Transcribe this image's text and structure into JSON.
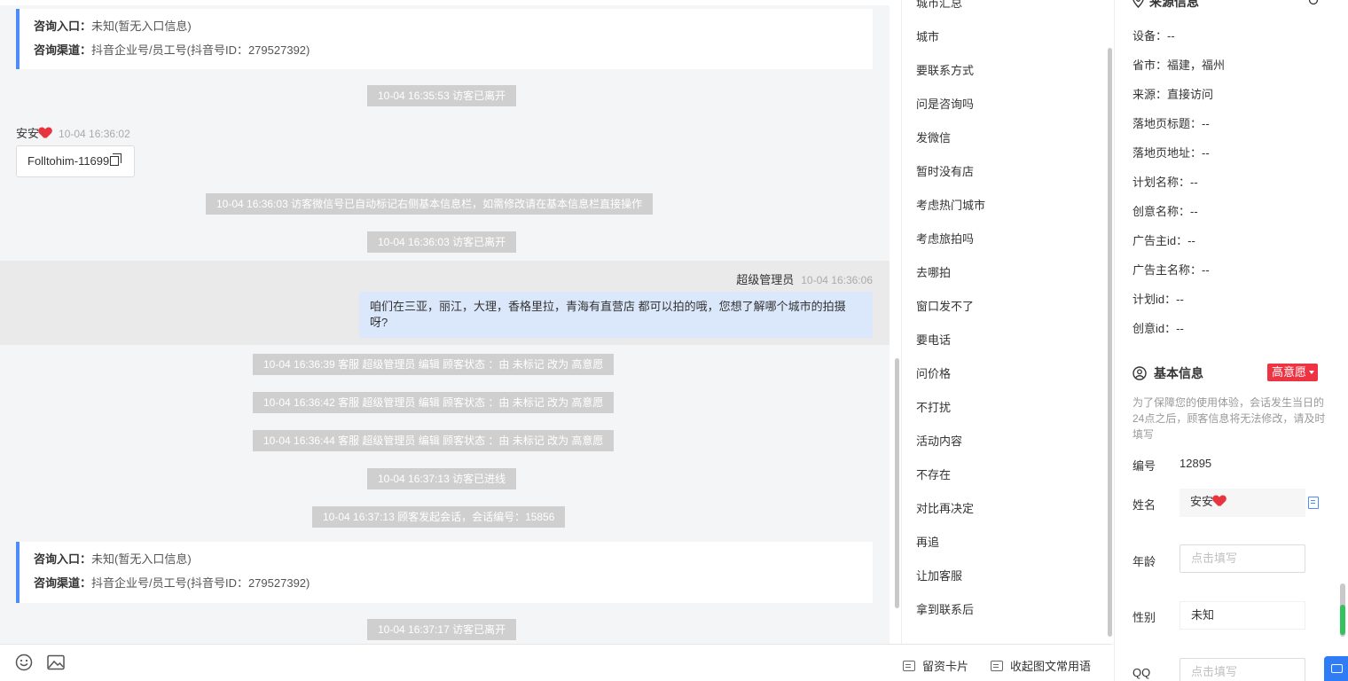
{
  "chat": {
    "card1": {
      "entry_label": "咨询入口：",
      "entry_value": "未知(暂无入口信息)",
      "channel_label": "咨询渠道：",
      "channel_value": "抖音企业号/员工号(抖音号ID：279527392)"
    },
    "sys1": "10-04 16:35:53 访客已离开",
    "visitor_name": "安安",
    "visitor_time": "10-04 16:36:02",
    "visitor_msg": "Folltohim-11699",
    "sys2": "10-04 16:36:03 访客微信号已自动标记右侧基本信息栏，如需修改请在基本信息栏直接操作",
    "sys3": "10-04 16:36:03 访客已离开",
    "admin_name": "超级管理员",
    "admin_time": "10-04 16:36:06",
    "admin_msg": "咱们在三亚，丽江，大理，香格里拉，青海有直营店 都可以拍的哦，您想了解哪个城市的拍摄呀?",
    "sys4": "10-04 16:36:39 客服 超级管理员 编辑 顾客状态 ：由 未标记 改为 高意愿",
    "sys5": "10-04 16:36:42 客服 超级管理员 编辑 顾客状态 ：由 未标记 改为 高意愿",
    "sys6": "10-04 16:36:44 客服 超级管理员 编辑 顾客状态 ：由 未标记 改为 高意愿",
    "sys7": "10-04 16:37:13 访客已进线",
    "sys8": "10-04 16:37:13 顾客发起会话，会话编号：15856",
    "card2": {
      "entry_label": "咨询入口：",
      "entry_value": "未知(暂无入口信息)",
      "channel_label": "咨询渠道：",
      "channel_value": "抖音企业号/员工号(抖音号ID：279527392)"
    },
    "sys9": "10-04 16:37:17 访客已离开"
  },
  "toolbar": {
    "emoji_icon": "smile-icon",
    "image_icon": "image-icon",
    "card_label": "留资卡片",
    "collapse_label": "收起图文常用语"
  },
  "quick_replies": {
    "partial_top": "城市汇总",
    "items": [
      "城市",
      "要联系方式",
      "问是咨询吗",
      "发微信",
      "暂时没有店",
      "考虑热门城市",
      "考虑旅拍吗",
      "去哪拍",
      "窗口发不了",
      "要电话",
      "问价格",
      "不打扰",
      "活动内容",
      "不存在",
      "对比再决定",
      "再追",
      "让加客服",
      "拿到联系后"
    ]
  },
  "side": {
    "source_title": "来源信息",
    "source": [
      {
        "k": "设备：",
        "v": "--"
      },
      {
        "k": "省市：",
        "v": "福建，福州"
      },
      {
        "k": "来源：",
        "v": "直接访问"
      },
      {
        "k": "落地页标题：",
        "v": "--"
      },
      {
        "k": "落地页地址：",
        "v": "--"
      },
      {
        "k": "计划名称：",
        "v": "--"
      },
      {
        "k": "创意名称：",
        "v": "--"
      },
      {
        "k": "广告主id：",
        "v": "--"
      },
      {
        "k": "广告主名称：",
        "v": "--"
      },
      {
        "k": "计划id：",
        "v": "--"
      },
      {
        "k": "创意id：",
        "v": "--"
      }
    ],
    "basic_title": "基本信息",
    "intent_badge": "高意愿",
    "notice": "为了保障您的使用体验，会话发生当日的24点之后，顾客信息将无法修改，请及时填写",
    "id_label": "编号",
    "id_value": "12895",
    "name_label": "姓名",
    "name_value": "安安",
    "age_label": "年龄",
    "age_placeholder": "点击填写",
    "gender_label": "性别",
    "gender_value": "未知",
    "qq_label": "QQ",
    "qq_placeholder": "点击填写"
  }
}
